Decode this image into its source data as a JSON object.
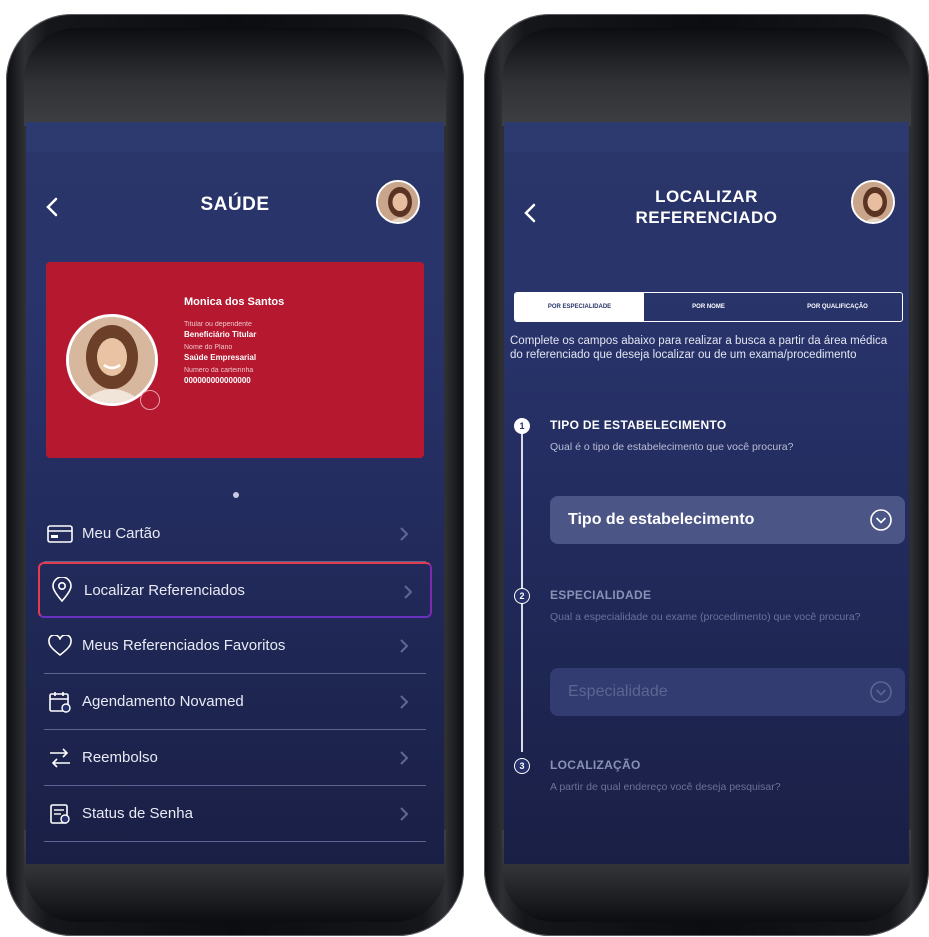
{
  "left_screen": {
    "title": "SAÚDE",
    "card": {
      "name": "Monica dos Santos",
      "holder_label": "Titular ou dependente",
      "holder_value": "Beneficiário Titular",
      "plan_label": "Nome do Plano",
      "plan_value": "Saúde Empresarial",
      "card_number_label": "Numero da carteirinha",
      "card_number_value": "000000000000000"
    },
    "menu": [
      {
        "label": "Meu Cartão",
        "icon": "card-icon"
      },
      {
        "label": "Localizar Referenciados",
        "icon": "location-pin-icon"
      },
      {
        "label": "Meus Referenciados Favoritos",
        "icon": "heart-icon"
      },
      {
        "label": "Agendamento Novamed",
        "icon": "calendar-icon"
      },
      {
        "label": "Reembolso",
        "icon": "transfer-arrows-icon"
      },
      {
        "label": "Status de Senha",
        "icon": "document-icon"
      }
    ]
  },
  "right_screen": {
    "title_line1": "LOCALIZAR",
    "title_line2": "REFERENCIADO",
    "tabs": [
      "POR ESPECIALIDADE",
      "POR NOME",
      "POR QUALIFICAÇÃO"
    ],
    "intro": "Complete os campos abaixo para realizar a busca a partir da área médica do referenciado que deseja localizar ou de um exama/procedimento",
    "steps": [
      {
        "number": "1",
        "title": "TIPO DE ESTABELECIMENTO",
        "description": "Qual é o tipo de estabelecimento que você procura?",
        "select": "Tipo de estabelecimento"
      },
      {
        "number": "2",
        "title": "ESPECIALIDADE",
        "description": "Qual a especialidade ou exame (procedimento) que você procura?",
        "select": "Especialidade"
      },
      {
        "number": "3",
        "title": "LOCALIZAÇÃO",
        "description": "A partir de qual endereço você deseja pesquisar?"
      }
    ]
  },
  "colors": {
    "screen_bg": "#28336a",
    "card_red": "#b5182f",
    "highlight_red": "#e23c4f",
    "highlight_purple": "#6a30c0"
  }
}
